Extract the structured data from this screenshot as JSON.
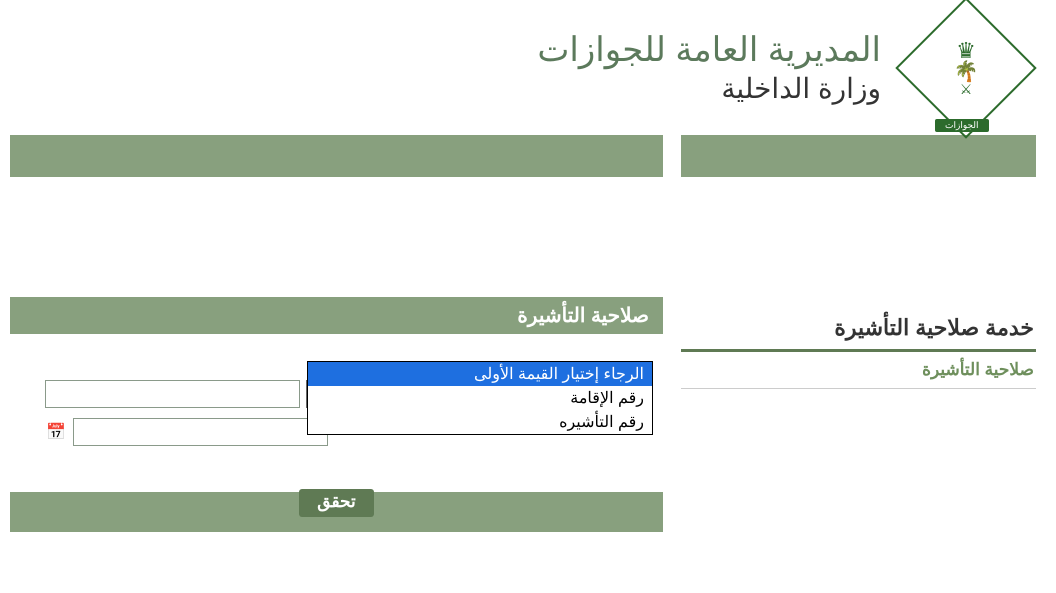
{
  "header": {
    "title_main": "المديرية العامة للجوازات",
    "title_sub": "وزارة الداخلية",
    "logo_banner": "الجوازات"
  },
  "sidebar": {
    "service_title": "خدمة صلاحية التأشيرة",
    "link_label": "صلاحية التأشيرة"
  },
  "panel": {
    "header": "صلاحية التأشيرة",
    "select_value": "رقم الإقامة",
    "verify_label": "تحقق"
  },
  "dropdown": {
    "options": [
      "الرجاء إختيار القيمة الأولى",
      "رقم الإقامة",
      "رقم التأشيره"
    ]
  }
}
